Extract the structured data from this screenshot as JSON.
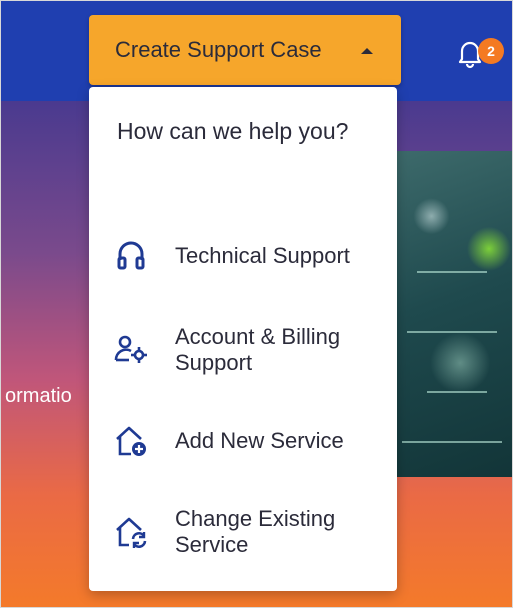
{
  "header": {
    "cta_label": "Create Support Case",
    "notification_count": "2"
  },
  "hero": {
    "partial_text": "ormatio"
  },
  "menu": {
    "heading": "How can we help you?",
    "items": [
      {
        "label": "Technical Support",
        "icon": "headset-icon"
      },
      {
        "label": "Account & Billing Support",
        "icon": "user-gear-icon"
      },
      {
        "label": "Add New Service",
        "icon": "home-plus-icon"
      },
      {
        "label": "Change Existing Service",
        "icon": "home-refresh-icon"
      }
    ]
  },
  "colors": {
    "topbar": "#1f3fb0",
    "cta_button": "#f6a62b",
    "badge": "#f47a22",
    "icon_blue": "#1f3a93",
    "text_dark": "#2b2b3a"
  }
}
